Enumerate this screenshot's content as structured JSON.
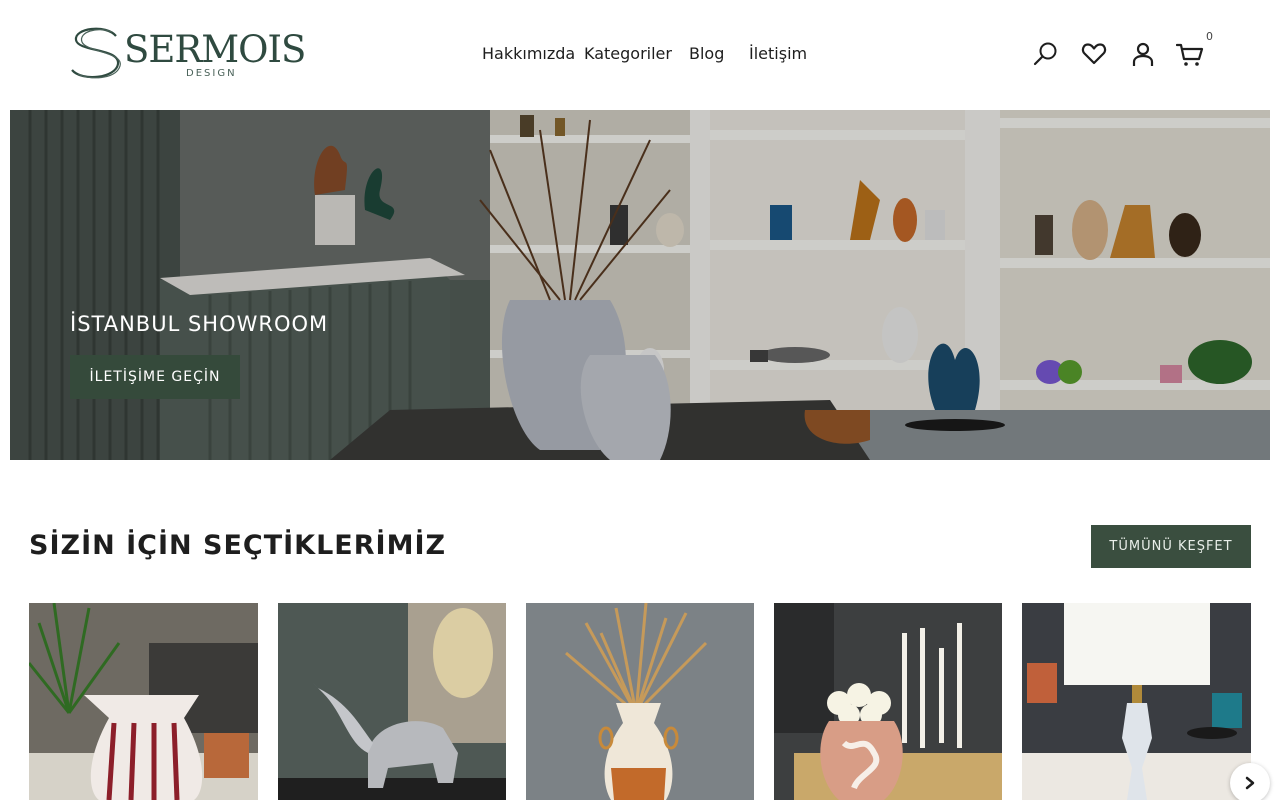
{
  "brand": {
    "name": "SERMOIS",
    "subtitle": "DESIGN"
  },
  "nav": {
    "items": [
      {
        "label": "Hakkımızda"
      },
      {
        "label": "Kategoriler"
      },
      {
        "label": "Blog"
      },
      {
        "label": "İletişim"
      }
    ]
  },
  "header_icons": {
    "search": "search-icon",
    "wishlist": "heart-icon",
    "account": "user-icon",
    "cart": "cart-icon",
    "cart_count": "0"
  },
  "hero": {
    "title": "İSTANBUL SHOWROOM",
    "button_label": "İLETİŞİME GEÇİN"
  },
  "featured": {
    "title": "SİZİN İÇİN SEÇTİKLERİMİZ",
    "explore_label": "TÜMÜNÜ KEŞFET",
    "products": [
      {
        "image": "striped-vase-with-palm"
      },
      {
        "image": "silver-elephant-figurine"
      },
      {
        "image": "vase-with-dried-pampas"
      },
      {
        "image": "pink-jar-with-tulips-and-candles"
      },
      {
        "image": "crystal-table-lamp"
      }
    ]
  },
  "colors": {
    "accent_green": "#354a3b",
    "text": "#1e1e1e",
    "logo": "#2f4a40"
  }
}
